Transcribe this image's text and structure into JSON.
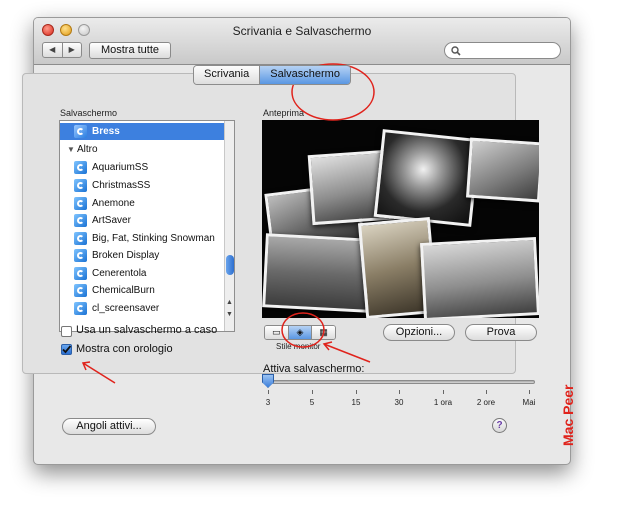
{
  "window": {
    "title": "Scrivania e Salvaschermo"
  },
  "toolbar": {
    "show_all_label": "Mostra tutte",
    "back_glyph": "◀",
    "forward_glyph": "▶",
    "search_placeholder": ""
  },
  "tabs": [
    {
      "label": "Scrivania",
      "selected": false
    },
    {
      "label": "Salvaschermo",
      "selected": true
    }
  ],
  "list": {
    "title": "Salvaschermo",
    "items": [
      {
        "label": "Bress",
        "selected": true,
        "type": "item"
      },
      {
        "label": "Altro",
        "selected": false,
        "type": "group"
      },
      {
        "label": "AquariumSS",
        "selected": false,
        "type": "item"
      },
      {
        "label": "ChristmasSS",
        "selected": false,
        "type": "item"
      },
      {
        "label": "Anemone",
        "selected": false,
        "type": "item"
      },
      {
        "label": "ArtSaver",
        "selected": false,
        "type": "item"
      },
      {
        "label": "Big, Fat, Stinking Snowman",
        "selected": false,
        "type": "item"
      },
      {
        "label": "Broken Display",
        "selected": false,
        "type": "item"
      },
      {
        "label": "Cenerentola",
        "selected": false,
        "type": "item"
      },
      {
        "label": "ChemicalBurn",
        "selected": false,
        "type": "item"
      },
      {
        "label": "cl_screensaver",
        "selected": false,
        "type": "item"
      }
    ]
  },
  "preview": {
    "title": "Anteprima"
  },
  "options": {
    "random_label": "Usa un salvaschermo a caso",
    "random_checked": false,
    "clock_label": "Mostra con orologio",
    "clock_checked": true
  },
  "monitor_style": {
    "label": "Stile monitor",
    "selected_index": 1
  },
  "buttons": {
    "options_label": "Opzioni...",
    "test_label": "Prova",
    "hot_corners_label": "Angoli attivi...",
    "help_label": "?"
  },
  "slider": {
    "label": "Attiva salvaschermo:",
    "ticks": [
      "3",
      "5",
      "15",
      "30",
      "1 ora",
      "2 ore",
      "Mai"
    ],
    "value_index": 0
  },
  "watermark": "Mac Peer",
  "colors": {
    "accent": "#3d80df",
    "annotation": "#e0231c"
  }
}
